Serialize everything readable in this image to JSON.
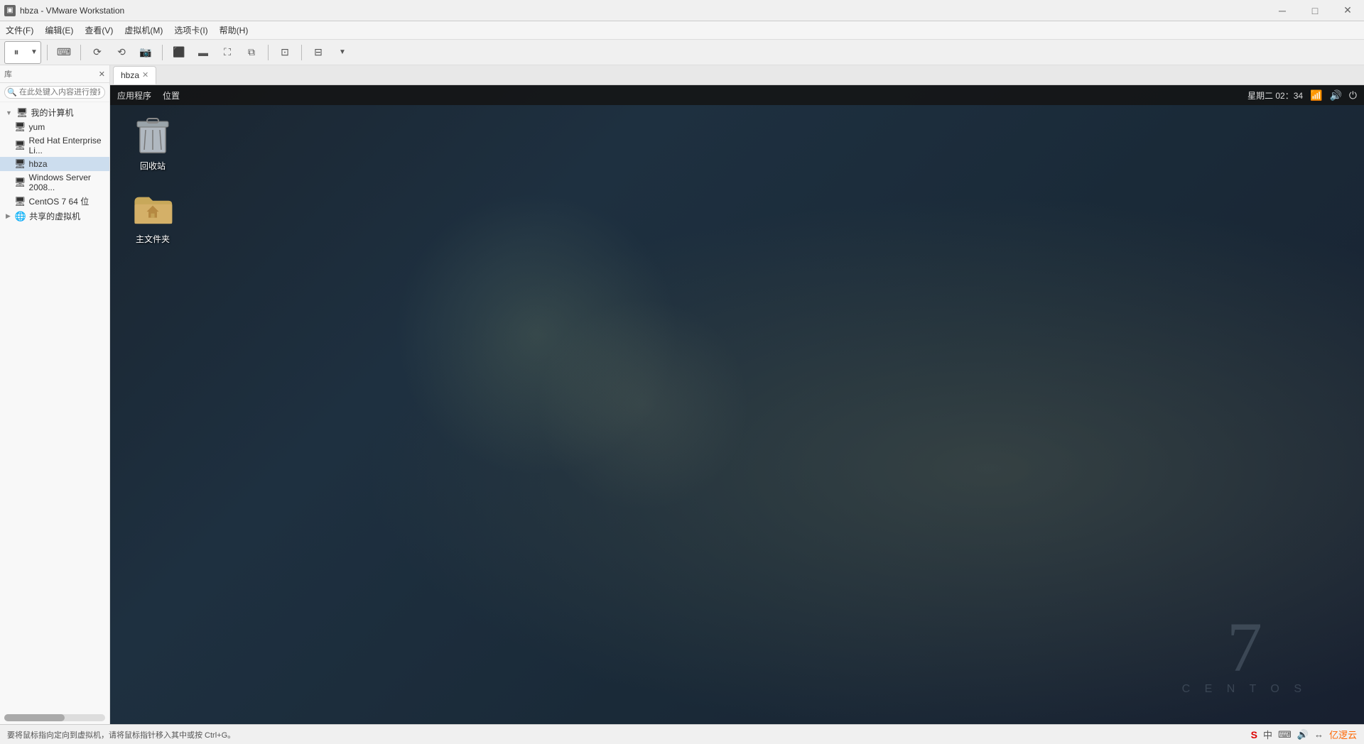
{
  "app": {
    "title": "hbza - VMware Workstation",
    "icon": "▣"
  },
  "titlebar": {
    "title": "hbza - VMware Workstation",
    "minimize": "─",
    "maximize": "□",
    "close": "✕"
  },
  "menubar": {
    "items": [
      "文件(F)",
      "编辑(E)",
      "查看(V)",
      "虚拟机(M)",
      "选项卡(I)",
      "帮助(H)"
    ]
  },
  "toolbar": {
    "pause_label": "⏸",
    "buttons": [
      "⏸",
      "💾",
      "↩",
      "↪",
      "📷"
    ]
  },
  "sidebar": {
    "header": "库",
    "search_placeholder": "在此处键入内容进行搜索",
    "tree": [
      {
        "label": "我的计算机",
        "indent": 0,
        "expanded": true,
        "type": "folder"
      },
      {
        "label": "yum",
        "indent": 1,
        "type": "vm"
      },
      {
        "label": "Red Hat Enterprise Li...",
        "indent": 1,
        "type": "vm"
      },
      {
        "label": "hbza",
        "indent": 1,
        "type": "vm",
        "selected": true
      },
      {
        "label": "Windows Server 2008...",
        "indent": 1,
        "type": "vm"
      },
      {
        "label": "CentOS 7 64 位",
        "indent": 1,
        "type": "vm"
      },
      {
        "label": "共享的虚拟机",
        "indent": 0,
        "type": "shared"
      }
    ]
  },
  "tabs": [
    {
      "label": "hbza",
      "active": true
    }
  ],
  "gnome": {
    "menu_apps": "应用程序",
    "menu_places": "位置",
    "time": "星期二 02：34",
    "icons": [
      "📶",
      "🔊",
      "⏻"
    ]
  },
  "desktop": {
    "icons": [
      {
        "name": "recycle-bin-icon",
        "label": "回收站"
      },
      {
        "name": "home-folder-icon",
        "label": "主文件夹"
      }
    ]
  },
  "centos_watermark": {
    "number": "7",
    "text": "C E N T O S"
  },
  "statusbar": {
    "hint": "要将鼠标指向定向到虚拟机，请将鼠标指针移入其中或按 Ctrl+G。",
    "right_icons": [
      "S",
      "中",
      "⌨",
      "🔊",
      "↔",
      "云"
    ]
  }
}
